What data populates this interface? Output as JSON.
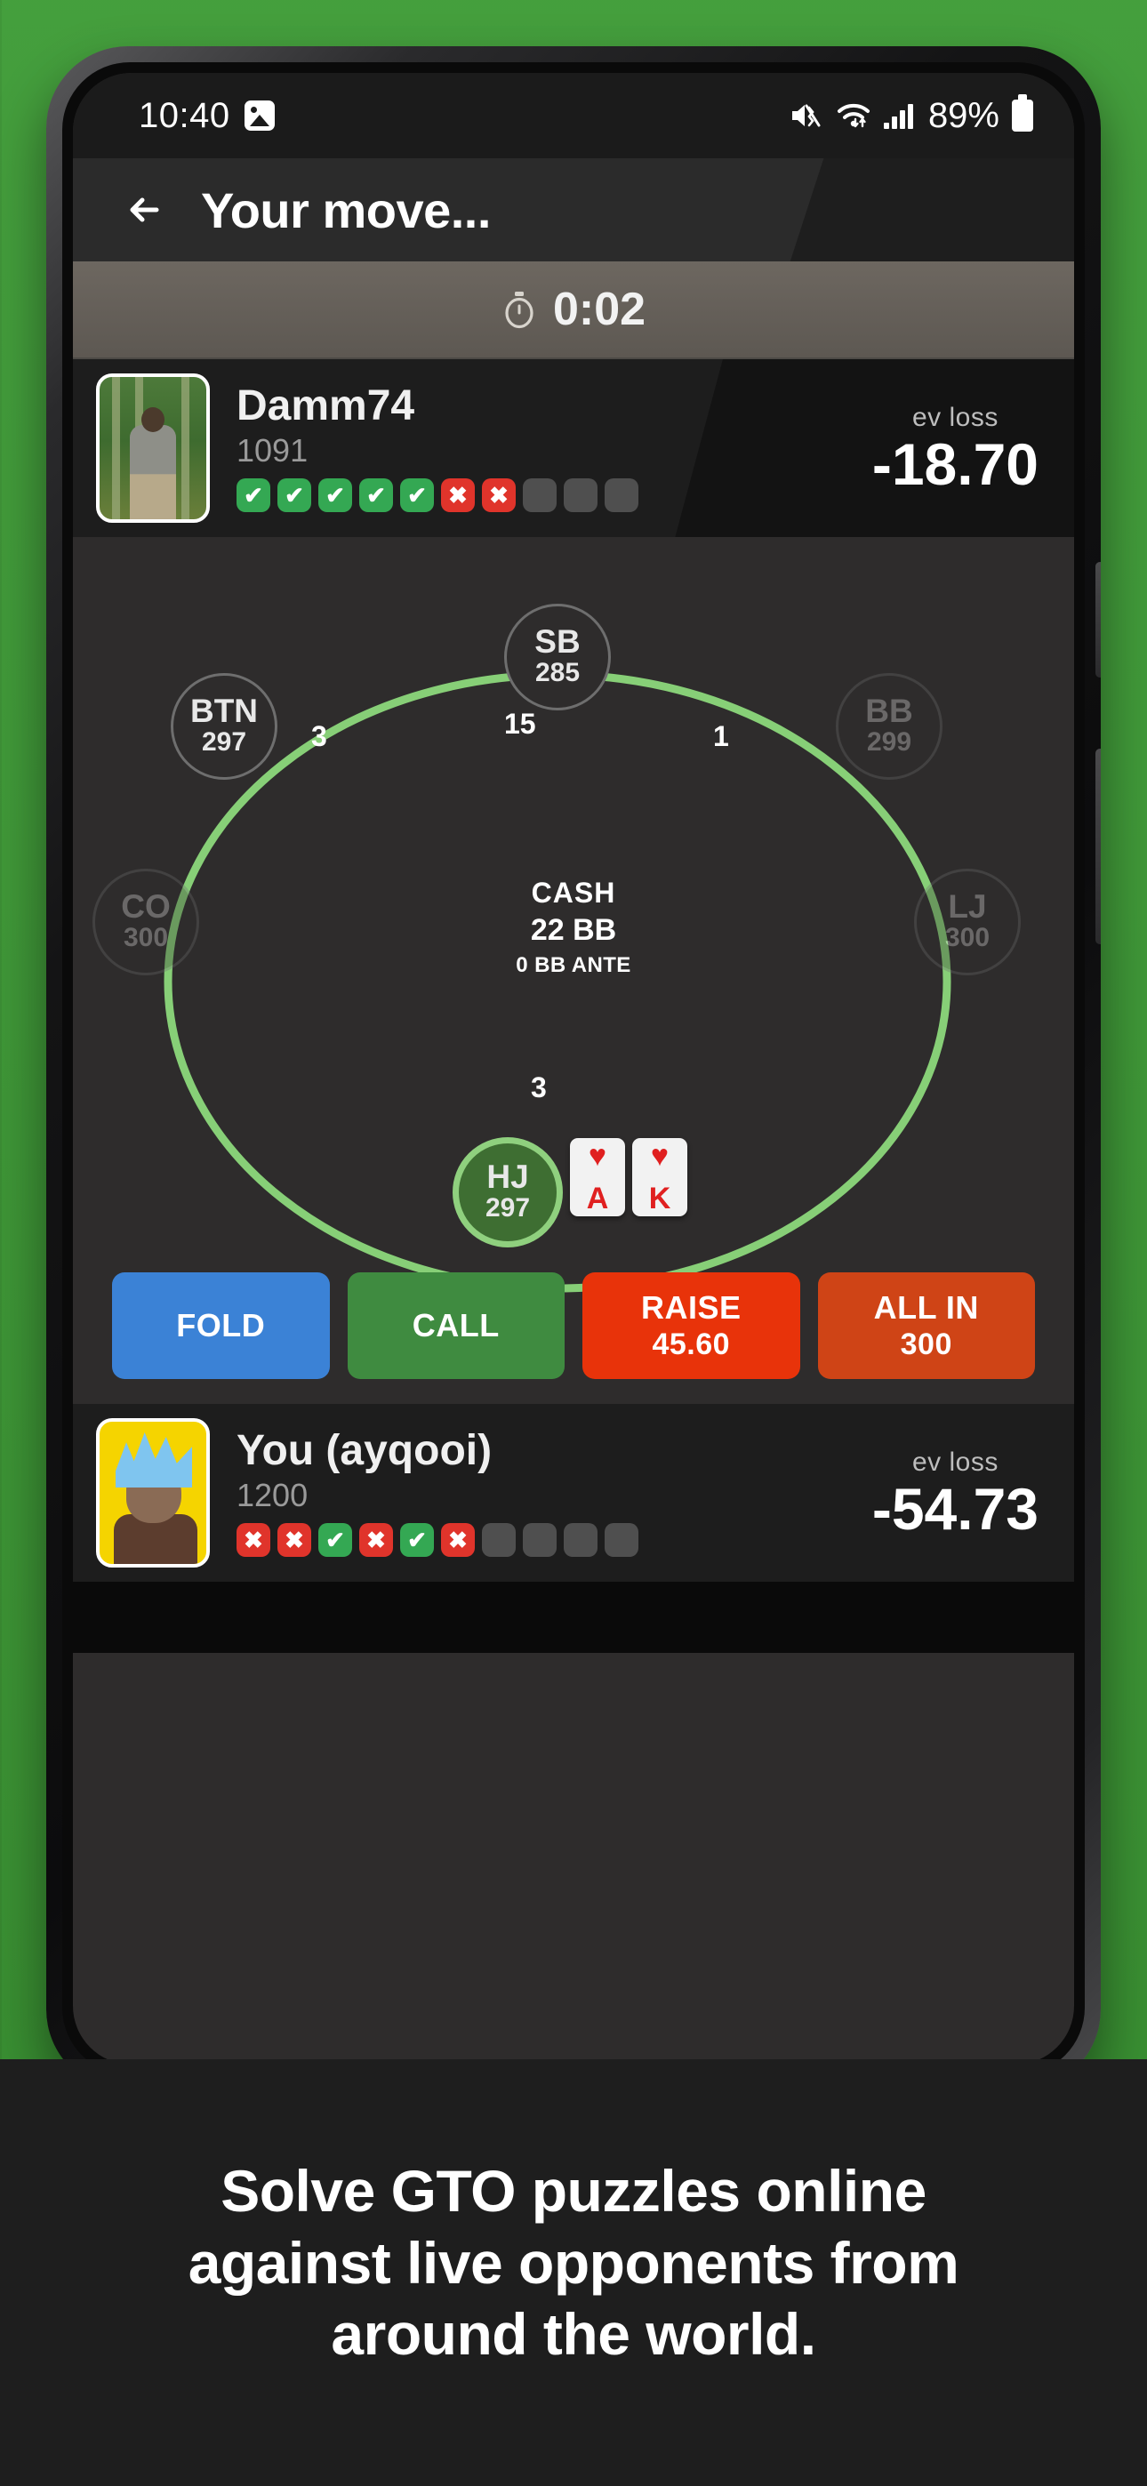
{
  "background": {
    "color": "#3d9b35"
  },
  "status_bar": {
    "time": "10:40",
    "photo_icon": "image-icon",
    "mute_icon": "volume-mute-icon",
    "wifi_icon": "wifi-icon",
    "signal_icon": "cellular-signal-icon",
    "battery_percent": "89%",
    "battery_icon": "battery-full-icon"
  },
  "header": {
    "back_icon": "back-arrow-icon",
    "title": "Your move..."
  },
  "timer": {
    "icon": "stopwatch-icon",
    "value": "0:02"
  },
  "opponent": {
    "avatar_alt": "forest-photo-avatar",
    "name": "Damm74",
    "rating": "1091",
    "ev_label": "ev loss",
    "ev_value": "-18.70",
    "streak": [
      "win",
      "win",
      "win",
      "win",
      "win",
      "loss",
      "loss",
      "empty",
      "empty",
      "empty"
    ]
  },
  "hero": {
    "avatar_alt": "anime-character-avatar",
    "name": "You (ayqooi)",
    "rating": "1200",
    "ev_label": "ev loss",
    "ev_value": "-54.73",
    "streak": [
      "loss",
      "loss",
      "win",
      "loss",
      "win",
      "loss",
      "empty",
      "empty",
      "empty",
      "empty"
    ]
  },
  "table": {
    "game_type": "CASH",
    "stack_depth": "22 BB",
    "ante": "0 BB ANTE",
    "seats": [
      {
        "position": "SB",
        "stack": "285",
        "state": "active"
      },
      {
        "position": "BTN",
        "stack": "297",
        "state": "active"
      },
      {
        "position": "BB",
        "stack": "299",
        "state": "folded"
      },
      {
        "position": "CO",
        "stack": "300",
        "state": "folded"
      },
      {
        "position": "LJ",
        "stack": "300",
        "state": "folded"
      },
      {
        "position": "HJ",
        "stack": "297",
        "state": "hero"
      }
    ],
    "bets": [
      {
        "seat": "BTN",
        "amount": "3"
      },
      {
        "seat": "POT",
        "amount": "15"
      },
      {
        "seat": "BB",
        "amount": "1"
      },
      {
        "seat": "HJ",
        "amount": "3"
      }
    ],
    "hole_cards": [
      {
        "rank": "A",
        "suit": "♥",
        "color": "red"
      },
      {
        "rank": "K",
        "suit": "♥",
        "color": "red"
      }
    ]
  },
  "actions": [
    {
      "label": "FOLD",
      "sub": "",
      "color": "#3b82d6"
    },
    {
      "label": "CALL",
      "sub": "",
      "color": "#3f8b40"
    },
    {
      "label": "RAISE",
      "sub": "45.60",
      "color": "#e8330a"
    },
    {
      "label": "ALL IN",
      "sub": "300",
      "color": "#cf4416"
    }
  ],
  "caption": {
    "line1": "Solve GTO puzzles online",
    "line2": "against live opponents from",
    "line3": "around the world."
  }
}
